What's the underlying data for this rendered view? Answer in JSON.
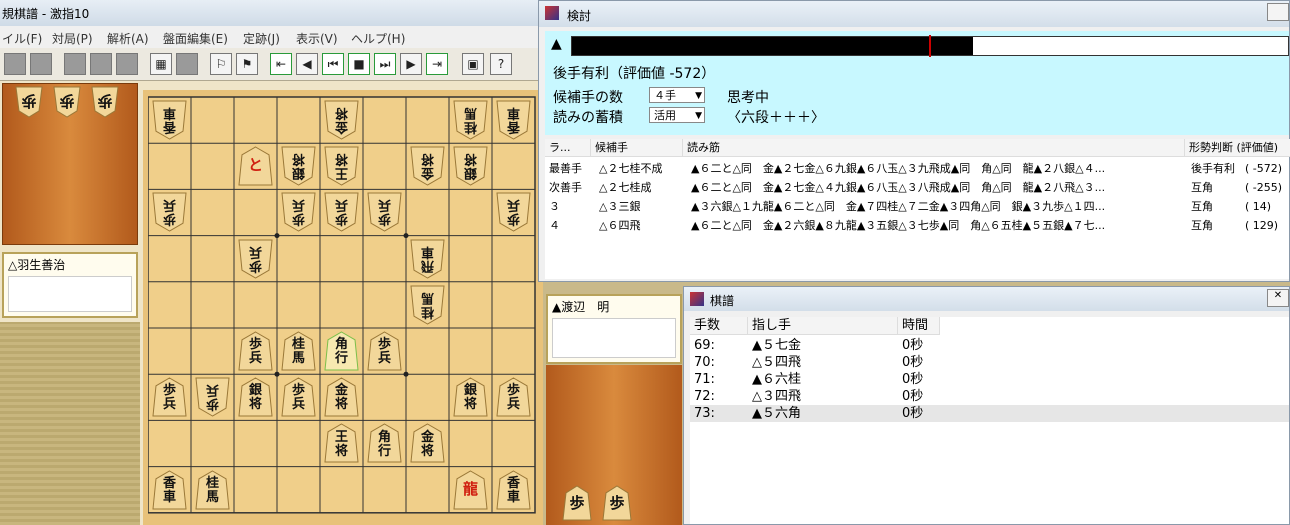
{
  "main": {
    "title": "規棋譜 - 激指10",
    "menu": [
      "イル(F)",
      "対局(P)",
      "解析(A)",
      "盤面編集(E)",
      "定跡(J)",
      "表示(V)",
      "ヘルプ(H)"
    ]
  },
  "players": {
    "gote_name": "△羽生善治",
    "sente_name": "▲渡辺　明"
  },
  "hand": {
    "gote": [
      "歩",
      "歩",
      "歩"
    ],
    "sente": [
      "歩",
      "歩"
    ]
  },
  "board": {
    "pieces": [
      {
        "c": 1,
        "r": 1,
        "t": "香車",
        "s": "g"
      },
      {
        "c": 5,
        "r": 1,
        "t": "金将",
        "s": "g"
      },
      {
        "c": 8,
        "r": 1,
        "t": "桂馬",
        "s": "g"
      },
      {
        "c": 9,
        "r": 1,
        "t": "香車",
        "s": "g"
      },
      {
        "c": 3,
        "r": 2,
        "t": "と",
        "s": "s",
        "promo": true
      },
      {
        "c": 4,
        "r": 2,
        "t": "銀将",
        "s": "g"
      },
      {
        "c": 5,
        "r": 2,
        "t": "王将",
        "s": "g"
      },
      {
        "c": 7,
        "r": 2,
        "t": "金将",
        "s": "g"
      },
      {
        "c": 8,
        "r": 2,
        "t": "銀将",
        "s": "g"
      },
      {
        "c": 1,
        "r": 3,
        "t": "歩兵",
        "s": "g"
      },
      {
        "c": 4,
        "r": 3,
        "t": "歩兵",
        "s": "g"
      },
      {
        "c": 5,
        "r": 3,
        "t": "歩兵",
        "s": "g"
      },
      {
        "c": 6,
        "r": 3,
        "t": "歩兵",
        "s": "g"
      },
      {
        "c": 9,
        "r": 3,
        "t": "歩兵",
        "s": "g"
      },
      {
        "c": 3,
        "r": 4,
        "t": "歩兵",
        "s": "g"
      },
      {
        "c": 7,
        "r": 4,
        "t": "飛車",
        "s": "g"
      },
      {
        "c": 7,
        "r": 5,
        "t": "桂馬",
        "s": "g"
      },
      {
        "c": 3,
        "r": 6,
        "t": "歩兵",
        "s": "s"
      },
      {
        "c": 4,
        "r": 6,
        "t": "桂馬",
        "s": "s"
      },
      {
        "c": 5,
        "r": 6,
        "t": "角行",
        "s": "s",
        "hl": true
      },
      {
        "c": 6,
        "r": 6,
        "t": "歩兵",
        "s": "s"
      },
      {
        "c": 1,
        "r": 7,
        "t": "歩兵",
        "s": "s"
      },
      {
        "c": 2,
        "r": 7,
        "t": "歩兵",
        "s": "g"
      },
      {
        "c": 3,
        "r": 7,
        "t": "銀将",
        "s": "s"
      },
      {
        "c": 4,
        "r": 7,
        "t": "歩兵",
        "s": "s"
      },
      {
        "c": 5,
        "r": 7,
        "t": "金将",
        "s": "s"
      },
      {
        "c": 8,
        "r": 7,
        "t": "銀将",
        "s": "s"
      },
      {
        "c": 9,
        "r": 7,
        "t": "歩兵",
        "s": "s"
      },
      {
        "c": 5,
        "r": 8,
        "t": "王将",
        "s": "s"
      },
      {
        "c": 6,
        "r": 8,
        "t": "角行",
        "s": "s"
      },
      {
        "c": 7,
        "r": 8,
        "t": "金将",
        "s": "s"
      },
      {
        "c": 1,
        "r": 9,
        "t": "香車",
        "s": "s"
      },
      {
        "c": 2,
        "r": 9,
        "t": "桂馬",
        "s": "s"
      },
      {
        "c": 8,
        "r": 9,
        "t": "龍",
        "s": "s",
        "promo": true
      },
      {
        "c": 9,
        "r": 9,
        "t": "香車",
        "s": "s"
      }
    ]
  },
  "analysis": {
    "title": "検討",
    "eval_marker": "▲",
    "eval_fill": 0.56,
    "status": "後手有利（評価値 -572）",
    "candidates_label": "候補手の数",
    "candidates_value": "４手",
    "thinking": "思考中",
    "storage_label": "読みの蓄積",
    "storage_value": "活用",
    "level": "〈六段＋＋＋〉",
    "headers": [
      "ラ...",
      "候補手",
      "読み筋",
      "形勢判断 (評価値)"
    ],
    "rows": [
      {
        "rank": "最善手",
        "move": "△２七桂不成",
        "line": "▲６二と△同　金▲２七金△６九銀▲６八玉△３九飛成▲同　角△同　龍▲２八銀△４...",
        "judge": "後手有利",
        "score": "( -572)"
      },
      {
        "rank": "次善手",
        "move": "△２七桂成",
        "line": "▲６二と△同　金▲２七金△４九銀▲６八玉△３八飛成▲同　角△同　龍▲２八飛△３...",
        "judge": "互角",
        "score": "( -255)"
      },
      {
        "rank": "３",
        "move": "△３三銀",
        "line": "▲３六銀△１九龍▲６二と△同　金▲７四桂△７二金▲３四角△同　銀▲３九歩△１四...",
        "judge": "互角",
        "score": "(    14)"
      },
      {
        "rank": "４",
        "move": "△６四飛",
        "line": "▲６二と△同　金▲２六銀▲８九龍▲３五銀△３七歩▲同　角△６五桂▲５五銀▲７七...",
        "judge": "互角",
        "score": "(  129)"
      }
    ]
  },
  "kifu": {
    "title": "棋譜",
    "headers": [
      "手数",
      "指し手",
      "時間"
    ],
    "moves": [
      {
        "n": "69:",
        "m": "▲５七金",
        "t": "0秒"
      },
      {
        "n": "70:",
        "m": "△５四飛",
        "t": "0秒"
      },
      {
        "n": "71:",
        "m": "▲６六桂",
        "t": "0秒"
      },
      {
        "n": "72:",
        "m": "△３四飛",
        "t": "0秒"
      },
      {
        "n": "73:",
        "m": "▲５六角",
        "t": "0秒"
      }
    ]
  },
  "colors": {
    "board": "#e8c27a",
    "piece": "#f2d79a",
    "info_bg": "#c8f8ff",
    "promoted": "#d02010"
  }
}
